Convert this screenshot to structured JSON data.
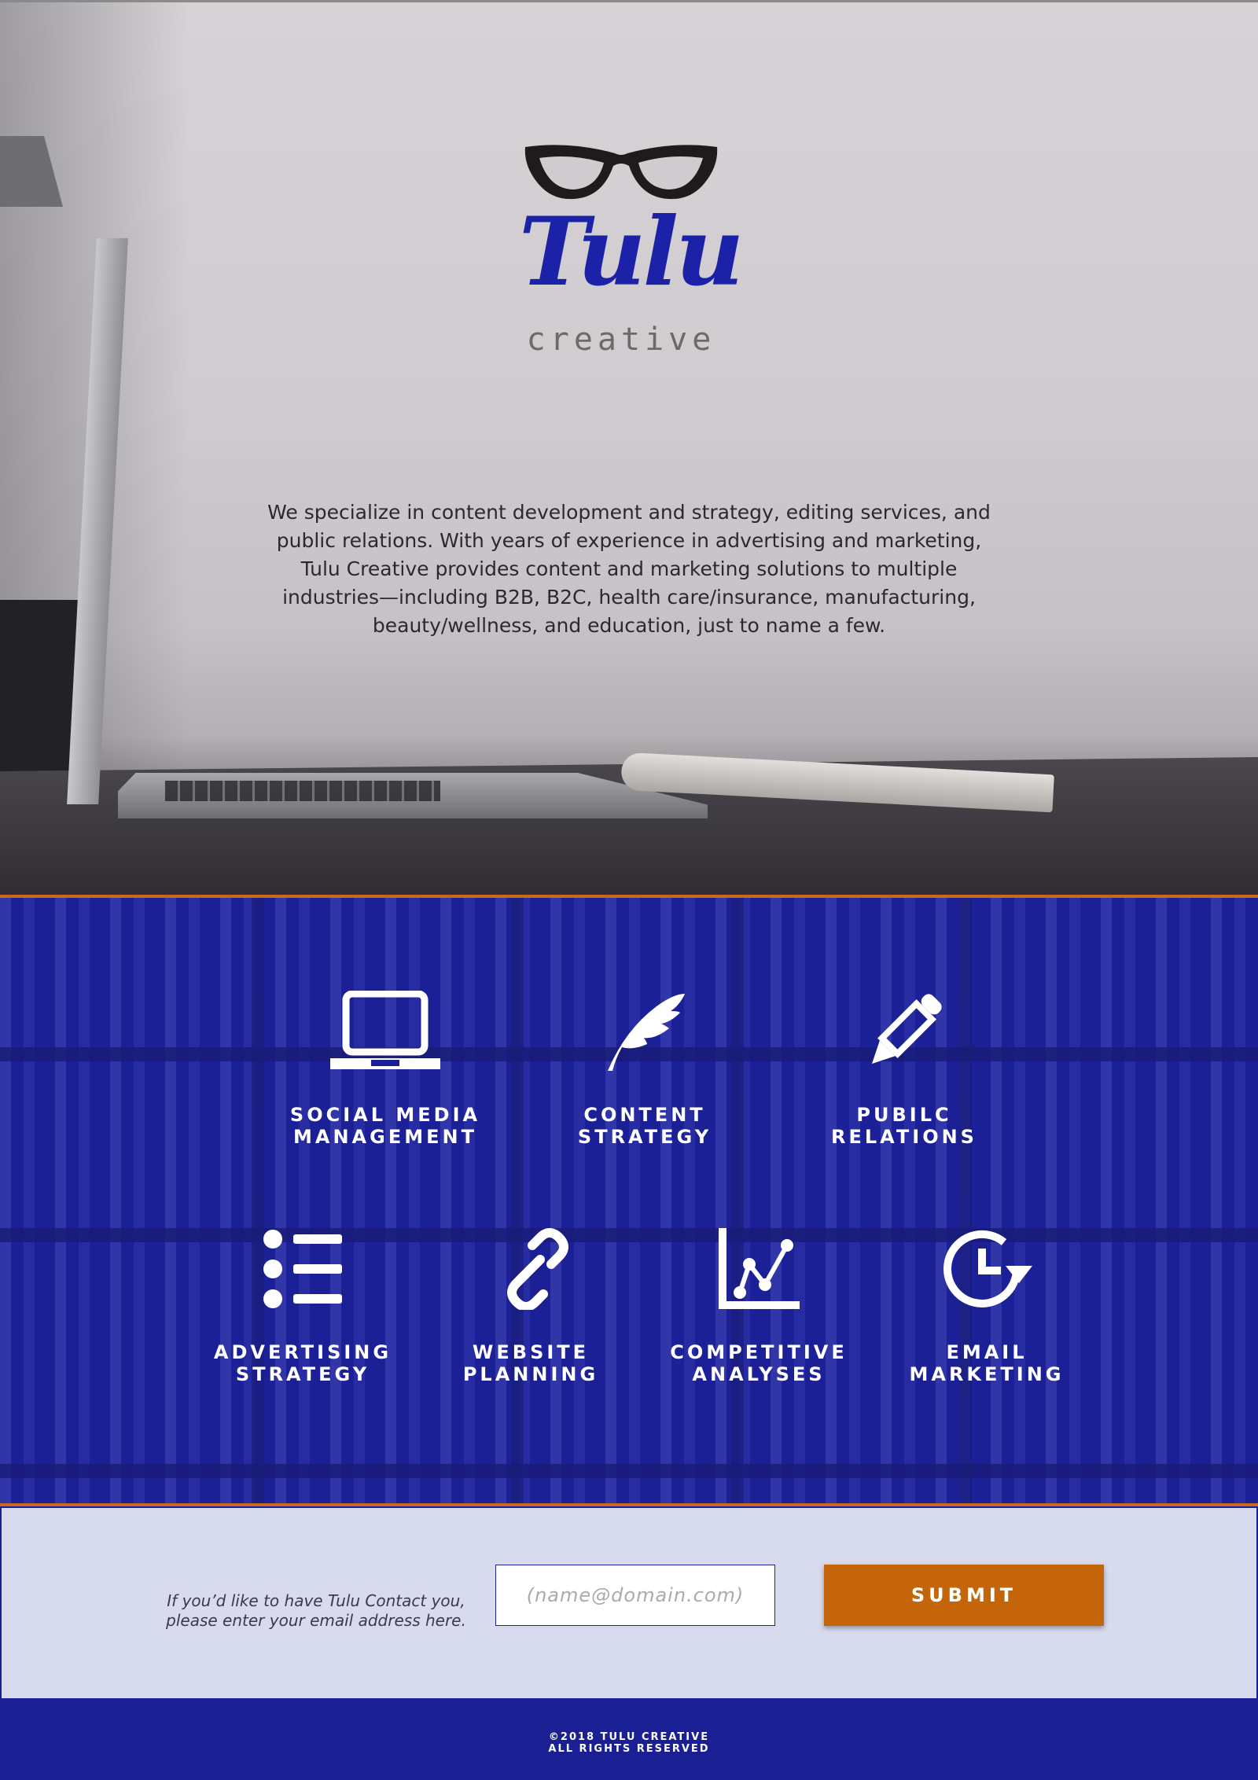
{
  "brand": {
    "name": "Tulu",
    "tagline": "creative",
    "color": "#1b22a8"
  },
  "intro": {
    "text": "We specialize in content development and strategy, editing services, and public relations. With years of experience in advertising and marketing, Tulu Creative provides content and marketing solutions to multiple industries—including B2B, B2C, health care/insurance, manufacturing, beauty/wellness, and education, just to name a few."
  },
  "services": {
    "items": [
      {
        "label": "SOCIAL MEDIA\nMANAGEMENT",
        "icon": "laptop-icon"
      },
      {
        "label": "CONTENT\nSTRATEGY",
        "icon": "feather-icon"
      },
      {
        "label": "PUBILC\nRELATIONS",
        "icon": "pencil-icon"
      },
      {
        "label": "ADVERTISING\nSTRATEGY",
        "icon": "list-icon"
      },
      {
        "label": "WEBSITE\nPLANNING",
        "icon": "link-icon"
      },
      {
        "label": "COMPETITIVE\nANALYSES",
        "icon": "line-chart-icon"
      },
      {
        "label": "EMAIL\nMARKETING",
        "icon": "clock-refresh-icon"
      }
    ],
    "accent": "#c8691f",
    "background": "#1c2096"
  },
  "contact": {
    "prompt": "If you’d like to have Tulu Contact you, please enter your email address here.",
    "email_placeholder": "(name@domain.com)",
    "email_value": "",
    "submit_label": "SUBMIT",
    "submit_color": "#c5650a"
  },
  "footer": {
    "copyright": "©2018 TULU CREATIVE",
    "rights": "ALL RIGHTS RESERVED"
  }
}
